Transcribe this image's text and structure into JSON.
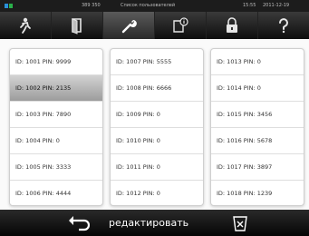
{
  "status_bar": {
    "left_text": "389 350",
    "title": "Список пользователей",
    "time": "15:55",
    "date": "2011-12-19"
  },
  "toolbar": {
    "icons": [
      "person-icon",
      "door-icon",
      "wrench-icon",
      "document-info-icon",
      "padlock-icon",
      "help-icon"
    ],
    "active_index": 2
  },
  "user_columns": [
    [
      "ID: 1001 PIN: 9999",
      "ID: 1002 PIN: 2135",
      "ID: 1003 PIN: 7890",
      "ID: 1004 PIN: 0",
      "ID: 1005 PIN: 3333",
      "ID: 1006 PIN: 4444"
    ],
    [
      "ID: 1007 PIN: 5555",
      "ID: 1008 PIN: 6666",
      "ID: 1009 PIN: 0",
      "ID: 1010 PIN: 0",
      "ID: 1011 PIN: 0",
      "ID: 1012 PIN: 0"
    ],
    [
      "ID: 1013 PIN: 0",
      "ID: 1014 PIN: 0",
      "ID: 1015 PIN: 3456",
      "ID: 1016 PIN: 5678",
      "ID: 1017 PIN: 3897",
      "ID: 1018 PIN: 1239"
    ]
  ],
  "selected_user": "ID: 1002 PIN: 2135",
  "bottom_bar": {
    "edit_label": "редактировать"
  },
  "colors": {
    "toolbar_bg": "#1a1a1a",
    "selected_row": "#b5b5b5",
    "bottom_text": "#ffffff"
  }
}
